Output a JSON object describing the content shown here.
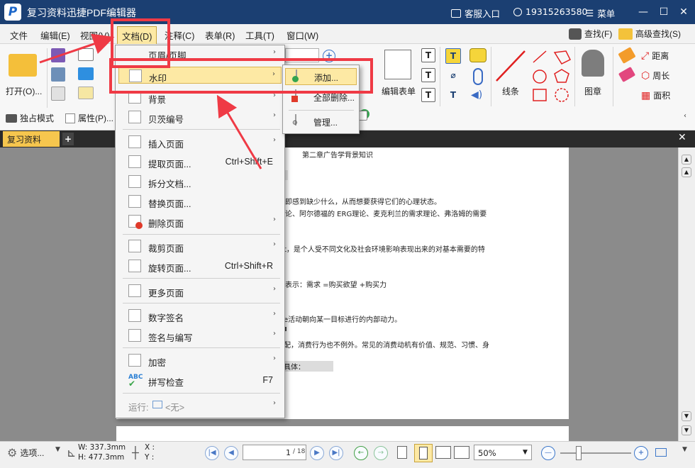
{
  "window": {
    "title": "复习资料迅捷PDF编辑器",
    "logo": "P",
    "service": "客服入口",
    "account": "19315263580",
    "menu": "菜单",
    "controls": [
      "—",
      "☐",
      "✕"
    ]
  },
  "menubar": [
    "文件",
    "编辑(E)",
    "视图(V)",
    "文档(D)",
    "注释(C)",
    "表单(R)",
    "工具(T)",
    "窗口(W)"
  ],
  "menubar_right": {
    "find": "查找(F)",
    "adv_find": "高级查找(S)"
  },
  "ribbon": {
    "open": "打开(O)...",
    "exclusive": "独占模式",
    "properties": "属性(P)...",
    "edit_form": "编辑表单",
    "line": "线条",
    "stamp": "图章",
    "distance": "距离",
    "perimeter": "周长",
    "area": "面积"
  },
  "doc_tab": "复习资料",
  "document_lines": [
    "第二章广告学背景知识",
    "即感到缺少什么，从而想要获得它们的心理状态。",
    "论、阿尔德福的          ERG理论、麦克利兰的需求理论、弗洛姆的需要",
    "t，是个人受不同文化及社会环境影响表现出来的对基本需要的特",
    "表示：需求       =购买欲望  +购买力",
    "e活动朝向某一目标进行的内部动力。",
    "配，消费行为也不例外。常见的消费动机有价值、规范、习惯、身",
    "具体："
  ],
  "doc_menu": {
    "partial_top": "页眉/页脚",
    "items": [
      {
        "label": "水印",
        "arrow": "›"
      },
      {
        "label": "背景",
        "arrow": "›"
      },
      {
        "label": "贝茨编号",
        "arrow": "›"
      },
      {
        "label": "插入页面",
        "arrow": "›"
      },
      {
        "label": "提取页面...",
        "shortcut": "Ctrl+Shift+E"
      },
      {
        "label": "拆分文档..."
      },
      {
        "label": "替换页面..."
      },
      {
        "label": "删除页面",
        "arrow": "›"
      },
      {
        "label": "裁剪页面",
        "arrow": "›"
      },
      {
        "label": "旋转页面...",
        "shortcut": "Ctrl+Shift+R"
      },
      {
        "label": "更多页面",
        "arrow": "›"
      },
      {
        "label": "数字签名",
        "arrow": "›"
      },
      {
        "label": "签名与编写",
        "arrow": "›"
      },
      {
        "label": "加密",
        "arrow": "›"
      },
      {
        "label": "拼写检查",
        "shortcut": "F7"
      },
      {
        "label": "运行:",
        "extra": "<无>",
        "arrow": "›"
      }
    ]
  },
  "watermark_submenu": [
    "添加...",
    "全部删除...",
    "管理..."
  ],
  "statusbar": {
    "select": "选项...",
    "width": "W: 337.3mm",
    "height": "H: 477.3mm",
    "x": "X :",
    "y": "Y :",
    "page_value": "1",
    "page_total": "/ 18",
    "zoom": "50%"
  },
  "colors": {
    "accent": "#f6c64e",
    "highlight": "#ef3a45",
    "titlebar": "#1b3f72"
  }
}
